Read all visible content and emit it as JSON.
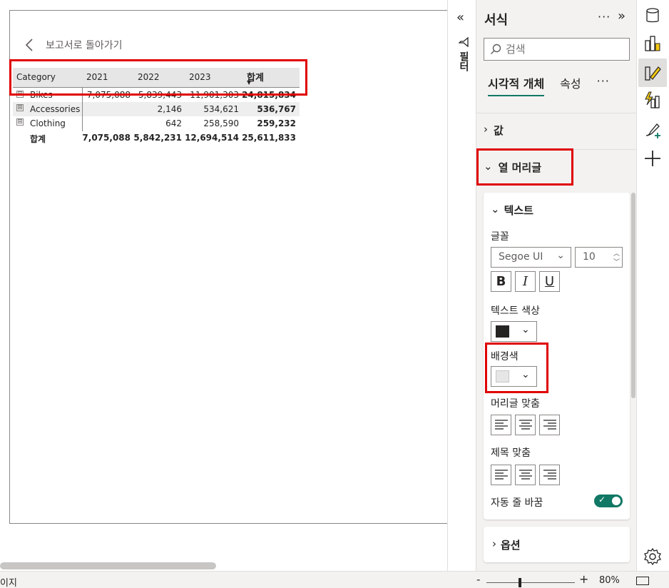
{
  "report": {
    "back_label": "보고서로 돌아가기",
    "matrix": {
      "headers": [
        "Category",
        "2021",
        "2022",
        "2023",
        "합계"
      ],
      "rows": [
        {
          "label": "Bikes",
          "v2021": "7,075,088",
          "v2022": "5,839,443",
          "v2023": "11,901,303",
          "total": "24,815,834"
        },
        {
          "label": "Accessories",
          "v2021": "",
          "v2022": "2,146",
          "v2023": "534,621",
          "total": "536,767"
        },
        {
          "label": "Clothing",
          "v2021": "",
          "v2022": "642",
          "v2023": "258,590",
          "total": "259,232"
        }
      ],
      "total_row": {
        "label": "합계",
        "v2021": "7,075,088",
        "v2022": "5,842,231",
        "v2023": "12,694,514",
        "total": "25,611,833"
      },
      "expand_symbol": "⊞"
    }
  },
  "filter": {
    "label": "필터",
    "collapse_icon": "«"
  },
  "pane": {
    "title": "서식",
    "more": "···",
    "collapse": "»",
    "search_placeholder": "검색",
    "tabs": [
      "시각적 개체",
      "속성",
      "···"
    ],
    "sections": {
      "values": "값",
      "column_headers": "열 머리글",
      "options": "옵션"
    },
    "text_card": {
      "title": "텍스트",
      "font_label": "글꼴",
      "font_family": "Segoe UI",
      "font_size": "10",
      "bold": "B",
      "italic": "I",
      "underline": "U",
      "text_color_label": "텍스트 색상",
      "text_color": "#252423",
      "bg_color_label": "배경색",
      "bg_color": "#e6e6e6",
      "header_align_label": "머리글 맞춤",
      "title_align_label": "제목 맞춤",
      "word_wrap_label": "자동 줄 바꿈",
      "word_wrap_on": true
    }
  },
  "status": {
    "left_text": "이지",
    "zoom_minus": "-",
    "zoom_plus": "+",
    "zoom_level": "80%",
    "zoom_fraction": 0.38
  },
  "colors": {
    "accent": "#117865",
    "highlight": "#e00000"
  }
}
